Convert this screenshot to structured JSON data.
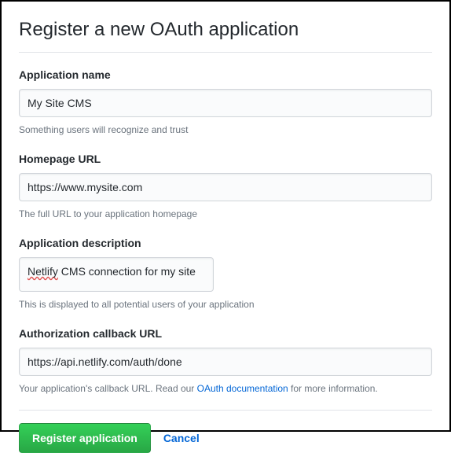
{
  "page_title": "Register a new OAuth application",
  "fields": {
    "app_name": {
      "label": "Application name",
      "value": "My Site CMS",
      "help": "Something users will recognize and trust"
    },
    "homepage_url": {
      "label": "Homepage URL",
      "value": "https://www.mysite.com",
      "help": "The full URL to your application homepage"
    },
    "description": {
      "label": "Application description",
      "value_word1": "Netlify",
      "value_rest": " CMS connection for my site",
      "help": "This is displayed to all potential users of your application"
    },
    "callback_url": {
      "label": "Authorization callback URL",
      "value": "https://api.netlify.com/auth/done",
      "help_prefix": "Your application's callback URL. Read our ",
      "help_link": "OAuth documentation",
      "help_suffix": " for more information."
    }
  },
  "actions": {
    "submit": "Register application",
    "cancel": "Cancel"
  }
}
